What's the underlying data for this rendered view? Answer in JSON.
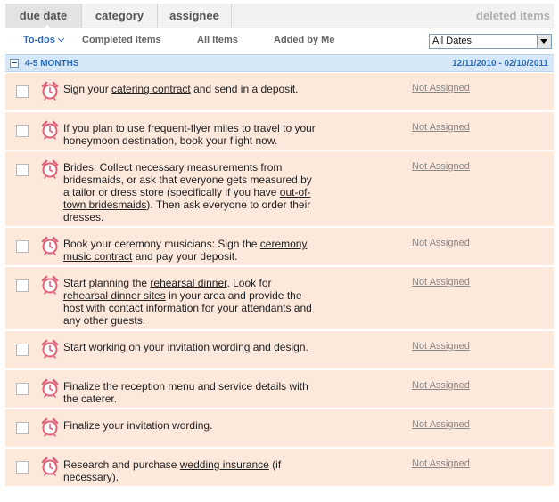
{
  "tabs": [
    {
      "label": "due date",
      "selected": true
    },
    {
      "label": "category",
      "selected": false
    },
    {
      "label": "assignee",
      "selected": false
    }
  ],
  "deleted_items_label": "deleted items",
  "subnav": [
    {
      "label": "To-dos",
      "selected": true
    },
    {
      "label": "Completed Items",
      "selected": false
    },
    {
      "label": "All Items",
      "selected": false
    },
    {
      "label": "Added by Me",
      "selected": false
    }
  ],
  "date_filter": {
    "selected": "All Dates"
  },
  "group": {
    "label": "4-5 MONTHS",
    "range": "12/11/2010 - 02/10/2011"
  },
  "colors": {
    "accent": "#2a6ab8",
    "row_bg": "#fde8dc",
    "group_bg": "#d6e7f7",
    "clock": "#e0637a"
  },
  "tasks": [
    {
      "parts": [
        {
          "t": "Sign your "
        },
        {
          "t": "catering contract",
          "link": true
        },
        {
          "t": " and send in a deposit."
        }
      ],
      "assigned": "Not Assigned"
    },
    {
      "parts": [
        {
          "t": "If you plan to use frequent-flyer miles to travel to your honeymoon destination, book your flight now."
        }
      ],
      "assigned": "Not Assigned"
    },
    {
      "parts": [
        {
          "t": "Brides: Collect necessary measurements from bridesmaids, or ask that everyone gets measured by a tailor or dress store (specifically if you have "
        },
        {
          "t": "out-of-town bridesmaids",
          "link": true
        },
        {
          "t": "). Then ask everyone to order their dresses."
        }
      ],
      "assigned": "Not Assigned"
    },
    {
      "parts": [
        {
          "t": "Book your ceremony musicians: Sign the "
        },
        {
          "t": "ceremony music contract",
          "link": true
        },
        {
          "t": " and pay your deposit."
        }
      ],
      "assigned": "Not Assigned"
    },
    {
      "parts": [
        {
          "t": "Start planning the "
        },
        {
          "t": "rehearsal dinner",
          "link": true
        },
        {
          "t": ". Look for "
        },
        {
          "t": "rehearsal dinner sites",
          "link": true
        },
        {
          "t": " in your area and provide the host with contact information for your attendants and any other guests."
        }
      ],
      "assigned": "Not Assigned"
    },
    {
      "parts": [
        {
          "t": "Start working on your "
        },
        {
          "t": "invitation wording",
          "link": true
        },
        {
          "t": " and design."
        }
      ],
      "assigned": "Not Assigned"
    },
    {
      "parts": [
        {
          "t": "Finalize the reception menu and service details with the caterer."
        }
      ],
      "assigned": "Not Assigned"
    },
    {
      "parts": [
        {
          "t": "Finalize your invitation wording."
        }
      ],
      "assigned": "Not Assigned"
    },
    {
      "parts": [
        {
          "t": "Research and purchase "
        },
        {
          "t": "wedding insurance",
          "link": true
        },
        {
          "t": " (if necessary)."
        }
      ],
      "assigned": "Not Assigned"
    }
  ]
}
